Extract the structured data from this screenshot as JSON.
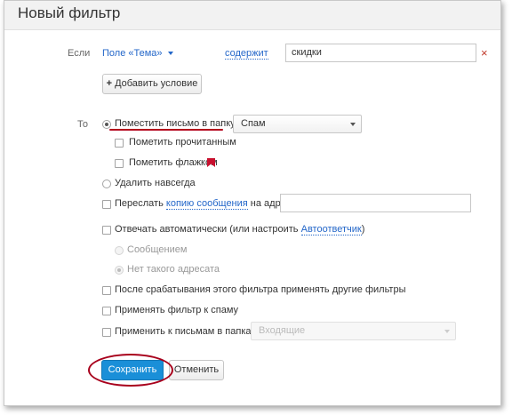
{
  "dialog": {
    "title": "Новый фильтр"
  },
  "condition": {
    "if_label": "Если",
    "field": "Поле «Тема»",
    "operator": "содержит",
    "value": "скидки",
    "remove_symbol": "×",
    "add_condition_label": "Добавить условие"
  },
  "actions": {
    "then_label": "То",
    "move_to_folder": {
      "label": "Поместить письмо в папку",
      "folder": "Спам",
      "checked": true
    },
    "mark_read": {
      "label": "Пометить прочитанным",
      "checked": false
    },
    "mark_flag": {
      "label": "Пометить флажком",
      "checked": false
    },
    "delete_forever": {
      "label": "Удалить навсегда",
      "checked": false
    },
    "forward": {
      "label_before": "Переслать",
      "link": "копию сообщения",
      "label_after": "на адрес",
      "value": ""
    },
    "autoreply": {
      "label_before": "Отвечать автоматически (или настроить",
      "link": "Автоответчик",
      "label_after": ")"
    },
    "autoreply_options": [
      {
        "label": "Сообщением",
        "checked": false
      },
      {
        "label": "Нет такого адресата",
        "checked": true
      }
    ],
    "apply_other": {
      "label": "После срабатывания этого фильтра применять другие фильтры",
      "checked": false
    },
    "apply_spam": {
      "label": "Применять фильтр к спаму",
      "checked": false
    },
    "apply_folders": {
      "label": "Применить к письмам в папках",
      "folder": "Входящие",
      "checked": false
    }
  },
  "buttons": {
    "save": "Сохранить",
    "cancel": "Отменить"
  },
  "colors": {
    "accent": "#1a8fd8",
    "link": "#2467c9",
    "annotation": "#b3001a",
    "flag": "#c8102e"
  }
}
